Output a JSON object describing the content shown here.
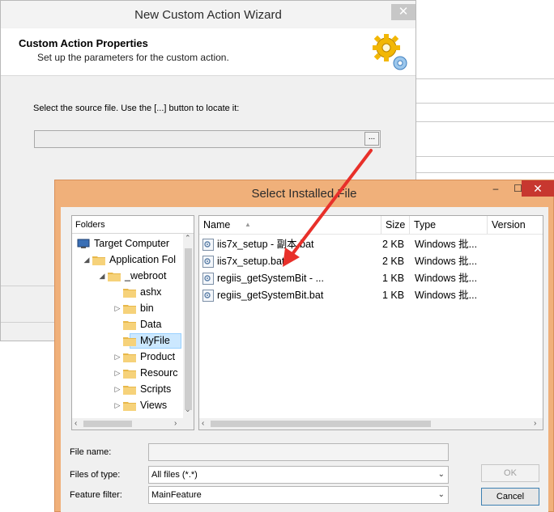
{
  "wizard": {
    "title": "New Custom Action Wizard",
    "close_glyph": "✕",
    "header_title": "Custom Action Properties",
    "header_subtitle": "Set up the parameters for the custom action.",
    "source_label": "Select the source file. Use the [...] button to locate it:",
    "source_value": "",
    "browse_label": "...",
    "header_icon": "gear-icon"
  },
  "dialog": {
    "title": "Select Installed File",
    "min_glyph": "–",
    "max_glyph": "☐",
    "close_glyph": "✕",
    "folders_header": "Folders",
    "tree": [
      {
        "label": "Target Computer",
        "arrow": "",
        "icon": "computer-icon",
        "indent": 0
      },
      {
        "label": "Application Fol",
        "arrow": "◢",
        "icon": "folder-icon",
        "indent": 1
      },
      {
        "label": "_webroot",
        "arrow": "◢",
        "icon": "folder-icon",
        "indent": 2
      },
      {
        "label": "ashx",
        "arrow": "",
        "icon": "folder-icon",
        "indent": 3
      },
      {
        "label": "bin",
        "arrow": "▷",
        "icon": "folder-icon",
        "indent": 3
      },
      {
        "label": "Data",
        "arrow": "",
        "icon": "folder-icon",
        "indent": 3
      },
      {
        "label": "MyFile",
        "arrow": "",
        "icon": "folder-icon",
        "indent": 3,
        "selected": true
      },
      {
        "label": "Product",
        "arrow": "▷",
        "icon": "folder-icon",
        "indent": 3
      },
      {
        "label": "Resourc",
        "arrow": "▷",
        "icon": "folder-icon",
        "indent": 3
      },
      {
        "label": "Scripts",
        "arrow": "▷",
        "icon": "folder-icon",
        "indent": 3
      },
      {
        "label": "Views",
        "arrow": "▷",
        "icon": "folder-icon",
        "indent": 3
      }
    ],
    "columns": {
      "name": "Name",
      "size": "Size",
      "type": "Type",
      "version": "Version",
      "sort_glyph": "▲"
    },
    "files": [
      {
        "name": "iis7x_setup - 副本.bat",
        "size": "2 KB",
        "type": "Windows 批..."
      },
      {
        "name": "iis7x_setup.bat",
        "size": "2 KB",
        "type": "Windows 批..."
      },
      {
        "name": "regiis_getSystemBit - ...",
        "size": "1 KB",
        "type": "Windows 批..."
      },
      {
        "name": "regiis_getSystemBit.bat",
        "size": "1 KB",
        "type": "Windows 批..."
      }
    ],
    "file_name_label": "File name:",
    "file_name_value": "",
    "files_of_type_label": "Files of type:",
    "files_of_type_value": "All files (*.*)",
    "feature_filter_label": "Feature filter:",
    "feature_filter_value": "MainFeature",
    "ok_label": "OK",
    "cancel_label": "Cancel"
  },
  "colors": {
    "dialog_frame": "#f0b07a",
    "close_red": "#c7372f",
    "arrow_red": "#e8302a",
    "selection": "#cce8ff"
  }
}
